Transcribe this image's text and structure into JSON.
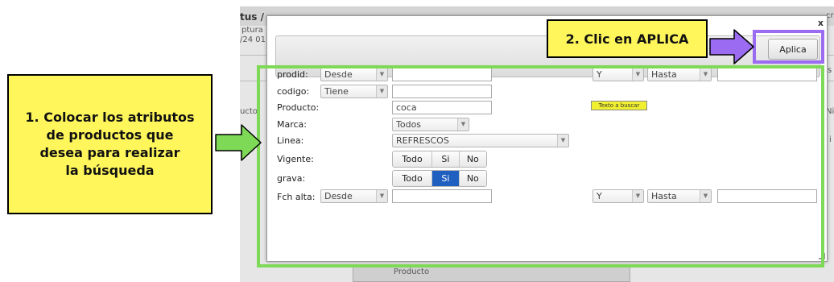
{
  "background": {
    "title_fragment": "tus /",
    "side_text_1": "ptura",
    "side_text_2": "/24 01",
    "side_text_3": "ucto",
    "right_text_1": "cr",
    "right_text_2": "s",
    "right_text_3": "Ni",
    "right_text_4": "i",
    "bottom_text": "Producto"
  },
  "dialog": {
    "close_label": "x",
    "apply_label": "Aplica"
  },
  "form": {
    "prodid": {
      "label": "prodid:",
      "mode": "Desde",
      "value": "",
      "op": "Y",
      "mode2": "Hasta",
      "value2": ""
    },
    "codigo": {
      "label": "codigo:",
      "mode": "Tiene",
      "value": ""
    },
    "producto": {
      "label": "Producto:",
      "value": "coca",
      "hint": "Texto a buscar"
    },
    "marca": {
      "label": "Marca:",
      "value": "Todos"
    },
    "linea": {
      "label": "Linea:",
      "value": "REFRESCOS"
    },
    "vigente": {
      "label": "Vigente:",
      "options": [
        "Todo",
        "Si",
        "No"
      ],
      "selected": ""
    },
    "grava": {
      "label": "grava:",
      "options": [
        "Todo",
        "Si",
        "No"
      ],
      "selected": "Si"
    },
    "fch_alta": {
      "label": "Fch alta:",
      "mode": "Desde",
      "value": "",
      "op": "Y",
      "mode2": "Hasta",
      "value2": ""
    }
  },
  "annotations": {
    "step1": "1. Colocar los atributos\nde productos que\ndesea para realizar\nla búsqueda",
    "step2": "2. Clic en APLICA"
  },
  "colors": {
    "callout_yellow": "#fef65b",
    "arrow_green": "#7ed957",
    "arrow_purple": "#9b6bf2",
    "selected_blue": "#1f5fbf"
  },
  "icons": {
    "dropdown": "caret-down-icon",
    "close": "close-icon",
    "arrow1": "right-arrow-icon",
    "arrow2": "right-arrow-icon"
  }
}
